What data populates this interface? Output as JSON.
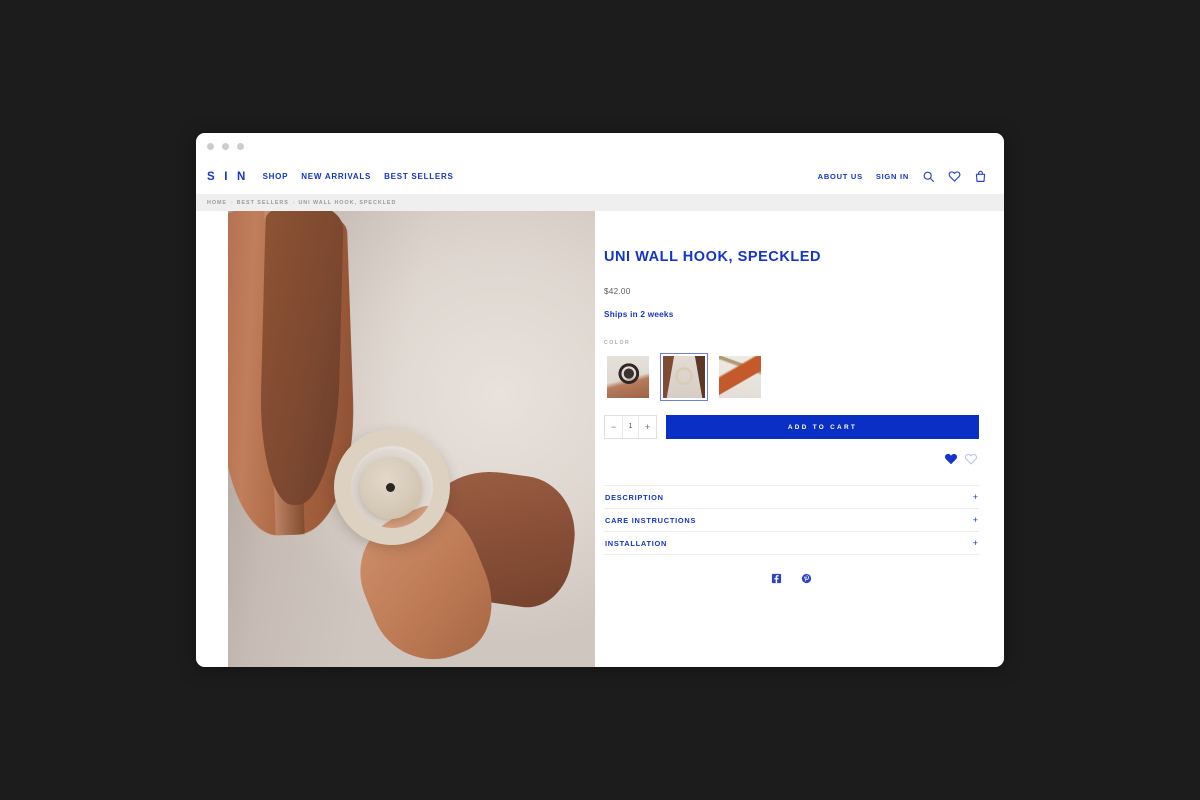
{
  "window": {
    "dots": [
      "close",
      "minimize",
      "maximize"
    ]
  },
  "nav": {
    "logo": "S I N",
    "links": [
      {
        "label": "SHOP"
      },
      {
        "label": "NEW ARRIVALS"
      },
      {
        "label": "BEST SELLERS"
      }
    ],
    "right_links": [
      {
        "label": "ABOUT US"
      },
      {
        "label": "SIGN IN"
      }
    ],
    "icons": [
      {
        "name": "search-icon"
      },
      {
        "name": "heart-icon"
      },
      {
        "name": "shopping-bag-icon"
      }
    ]
  },
  "breadcrumb": {
    "separator": "›",
    "items": [
      {
        "label": "HOME"
      },
      {
        "label": "BEST SELLERS"
      },
      {
        "label": "UNI WALL HOOK, SPECKLED"
      }
    ]
  },
  "product": {
    "title": "UNI WALL HOOK, SPECKLED",
    "price": "$42.00",
    "shipping": "Ships in 2 weeks",
    "color_label": "COLOR",
    "swatches": [
      {
        "name": "dark-hook-thumbnail",
        "selected": false
      },
      {
        "name": "speckled-hook-thumbnail",
        "selected": true
      },
      {
        "name": "terracotta-vase-thumbnail",
        "selected": false
      }
    ],
    "quantity": {
      "decrement": "−",
      "value": "1",
      "increment": "+"
    },
    "add_to_cart": "ADD TO CART",
    "wishlist": [
      {
        "name": "heart-filled-icon",
        "state": "filled"
      },
      {
        "name": "heart-outline-icon",
        "state": "outline"
      }
    ],
    "accordion": [
      {
        "label": "DESCRIPTION",
        "toggle": "+"
      },
      {
        "label": "CARE INSTRUCTIONS",
        "toggle": "+"
      },
      {
        "label": "INSTALLATION",
        "toggle": "+"
      }
    ],
    "social": [
      {
        "name": "facebook-icon"
      },
      {
        "name": "pinterest-icon"
      }
    ]
  },
  "colors": {
    "brand_blue": "#1434CB",
    "button_blue": "#0A2FC4",
    "page_background": "#1c1c1c",
    "breadcrumb_bar": "#efefef"
  }
}
